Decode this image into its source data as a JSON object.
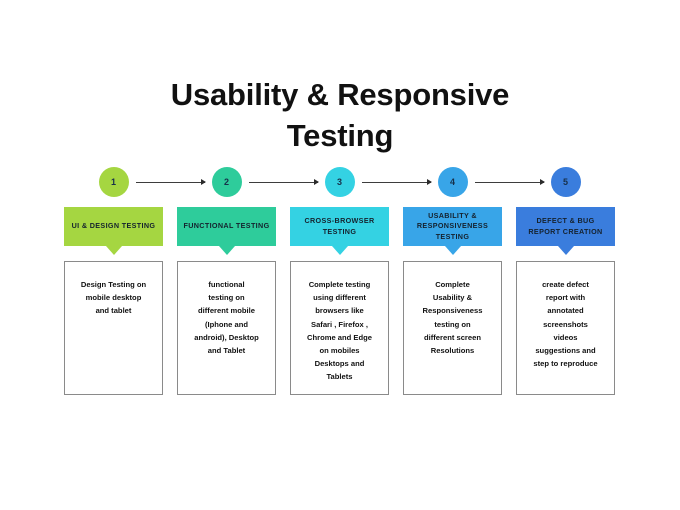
{
  "title": "Usability & Responsive\nTesting",
  "colors": {
    "step1": "#a5d641",
    "step2": "#2ecc9b",
    "step3": "#34d2e3",
    "step4": "#38a5e8",
    "step5": "#3a7ddd",
    "arrow": "#3d3d3d",
    "box_border": "#8a8a8a",
    "text": "#111111"
  },
  "steps": [
    {
      "number": "1",
      "color": "#a5d641",
      "header": "UI & DESIGN TESTING",
      "body": "Design Testing on\nmobile desktop\nand tablet"
    },
    {
      "number": "2",
      "color": "#2ecc9b",
      "header": "FUNCTIONAL TESTING",
      "body": "functional\ntesting on\ndifferent mobile\n(Iphone and\nandroid), Desktop\nand Tablet"
    },
    {
      "number": "3",
      "color": "#34d2e3",
      "header": "CROSS-BROWSER TESTING",
      "body": "Complete testing\nusing different\nbrowsers like\nSafari , Firefox ,\nChrome and Edge\non mobiles\nDesktops and\nTablets"
    },
    {
      "number": "4",
      "color": "#38a5e8",
      "header": "USABILITY & RESPONSIVENESS TESTING",
      "body": "Complete\nUsability &\nResponsiveness\ntesting on\ndifferent screen\nResolutions"
    },
    {
      "number": "5",
      "color": "#3a7ddd",
      "header": "DEFECT & BUG REPORT CREATION",
      "body": "create defect\nreport with\nannotated\nscreenshots\nvideos\nsuggestions and\nstep to reproduce"
    }
  ],
  "arrows": [
    {
      "name": "arrow-1-to-2"
    },
    {
      "name": "arrow-2-to-3"
    },
    {
      "name": "arrow-3-to-4"
    },
    {
      "name": "arrow-4-to-5"
    }
  ]
}
